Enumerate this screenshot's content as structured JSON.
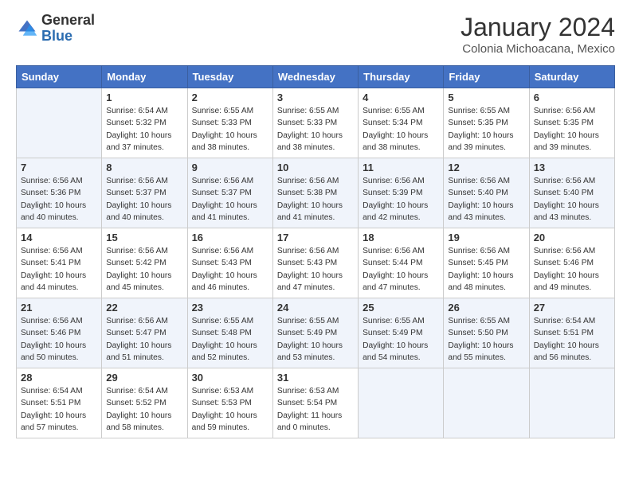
{
  "header": {
    "logo_general": "General",
    "logo_blue": "Blue",
    "title": "January 2024",
    "subtitle": "Colonia Michoacana, Mexico"
  },
  "days_of_week": [
    "Sunday",
    "Monday",
    "Tuesday",
    "Wednesday",
    "Thursday",
    "Friday",
    "Saturday"
  ],
  "weeks": [
    [
      {
        "day": "",
        "empty": true
      },
      {
        "day": "1",
        "sunrise": "6:54 AM",
        "sunset": "5:32 PM",
        "daylight": "10 hours and 37 minutes."
      },
      {
        "day": "2",
        "sunrise": "6:55 AM",
        "sunset": "5:33 PM",
        "daylight": "10 hours and 38 minutes."
      },
      {
        "day": "3",
        "sunrise": "6:55 AM",
        "sunset": "5:33 PM",
        "daylight": "10 hours and 38 minutes."
      },
      {
        "day": "4",
        "sunrise": "6:55 AM",
        "sunset": "5:34 PM",
        "daylight": "10 hours and 38 minutes."
      },
      {
        "day": "5",
        "sunrise": "6:55 AM",
        "sunset": "5:35 PM",
        "daylight": "10 hours and 39 minutes."
      },
      {
        "day": "6",
        "sunrise": "6:56 AM",
        "sunset": "5:35 PM",
        "daylight": "10 hours and 39 minutes."
      }
    ],
    [
      {
        "day": "7",
        "sunrise": "6:56 AM",
        "sunset": "5:36 PM",
        "daylight": "10 hours and 40 minutes."
      },
      {
        "day": "8",
        "sunrise": "6:56 AM",
        "sunset": "5:37 PM",
        "daylight": "10 hours and 40 minutes."
      },
      {
        "day": "9",
        "sunrise": "6:56 AM",
        "sunset": "5:37 PM",
        "daylight": "10 hours and 41 minutes."
      },
      {
        "day": "10",
        "sunrise": "6:56 AM",
        "sunset": "5:38 PM",
        "daylight": "10 hours and 41 minutes."
      },
      {
        "day": "11",
        "sunrise": "6:56 AM",
        "sunset": "5:39 PM",
        "daylight": "10 hours and 42 minutes."
      },
      {
        "day": "12",
        "sunrise": "6:56 AM",
        "sunset": "5:40 PM",
        "daylight": "10 hours and 43 minutes."
      },
      {
        "day": "13",
        "sunrise": "6:56 AM",
        "sunset": "5:40 PM",
        "daylight": "10 hours and 43 minutes."
      }
    ],
    [
      {
        "day": "14",
        "sunrise": "6:56 AM",
        "sunset": "5:41 PM",
        "daylight": "10 hours and 44 minutes."
      },
      {
        "day": "15",
        "sunrise": "6:56 AM",
        "sunset": "5:42 PM",
        "daylight": "10 hours and 45 minutes."
      },
      {
        "day": "16",
        "sunrise": "6:56 AM",
        "sunset": "5:43 PM",
        "daylight": "10 hours and 46 minutes."
      },
      {
        "day": "17",
        "sunrise": "6:56 AM",
        "sunset": "5:43 PM",
        "daylight": "10 hours and 47 minutes."
      },
      {
        "day": "18",
        "sunrise": "6:56 AM",
        "sunset": "5:44 PM",
        "daylight": "10 hours and 47 minutes."
      },
      {
        "day": "19",
        "sunrise": "6:56 AM",
        "sunset": "5:45 PM",
        "daylight": "10 hours and 48 minutes."
      },
      {
        "day": "20",
        "sunrise": "6:56 AM",
        "sunset": "5:46 PM",
        "daylight": "10 hours and 49 minutes."
      }
    ],
    [
      {
        "day": "21",
        "sunrise": "6:56 AM",
        "sunset": "5:46 PM",
        "daylight": "10 hours and 50 minutes."
      },
      {
        "day": "22",
        "sunrise": "6:56 AM",
        "sunset": "5:47 PM",
        "daylight": "10 hours and 51 minutes."
      },
      {
        "day": "23",
        "sunrise": "6:55 AM",
        "sunset": "5:48 PM",
        "daylight": "10 hours and 52 minutes."
      },
      {
        "day": "24",
        "sunrise": "6:55 AM",
        "sunset": "5:49 PM",
        "daylight": "10 hours and 53 minutes."
      },
      {
        "day": "25",
        "sunrise": "6:55 AM",
        "sunset": "5:49 PM",
        "daylight": "10 hours and 54 minutes."
      },
      {
        "day": "26",
        "sunrise": "6:55 AM",
        "sunset": "5:50 PM",
        "daylight": "10 hours and 55 minutes."
      },
      {
        "day": "27",
        "sunrise": "6:54 AM",
        "sunset": "5:51 PM",
        "daylight": "10 hours and 56 minutes."
      }
    ],
    [
      {
        "day": "28",
        "sunrise": "6:54 AM",
        "sunset": "5:51 PM",
        "daylight": "10 hours and 57 minutes."
      },
      {
        "day": "29",
        "sunrise": "6:54 AM",
        "sunset": "5:52 PM",
        "daylight": "10 hours and 58 minutes."
      },
      {
        "day": "30",
        "sunrise": "6:53 AM",
        "sunset": "5:53 PM",
        "daylight": "10 hours and 59 minutes."
      },
      {
        "day": "31",
        "sunrise": "6:53 AM",
        "sunset": "5:54 PM",
        "daylight": "11 hours and 0 minutes."
      },
      {
        "day": "",
        "empty": true
      },
      {
        "day": "",
        "empty": true
      },
      {
        "day": "",
        "empty": true
      }
    ]
  ],
  "labels": {
    "sunrise": "Sunrise:",
    "sunset": "Sunset:",
    "daylight": "Daylight:"
  }
}
